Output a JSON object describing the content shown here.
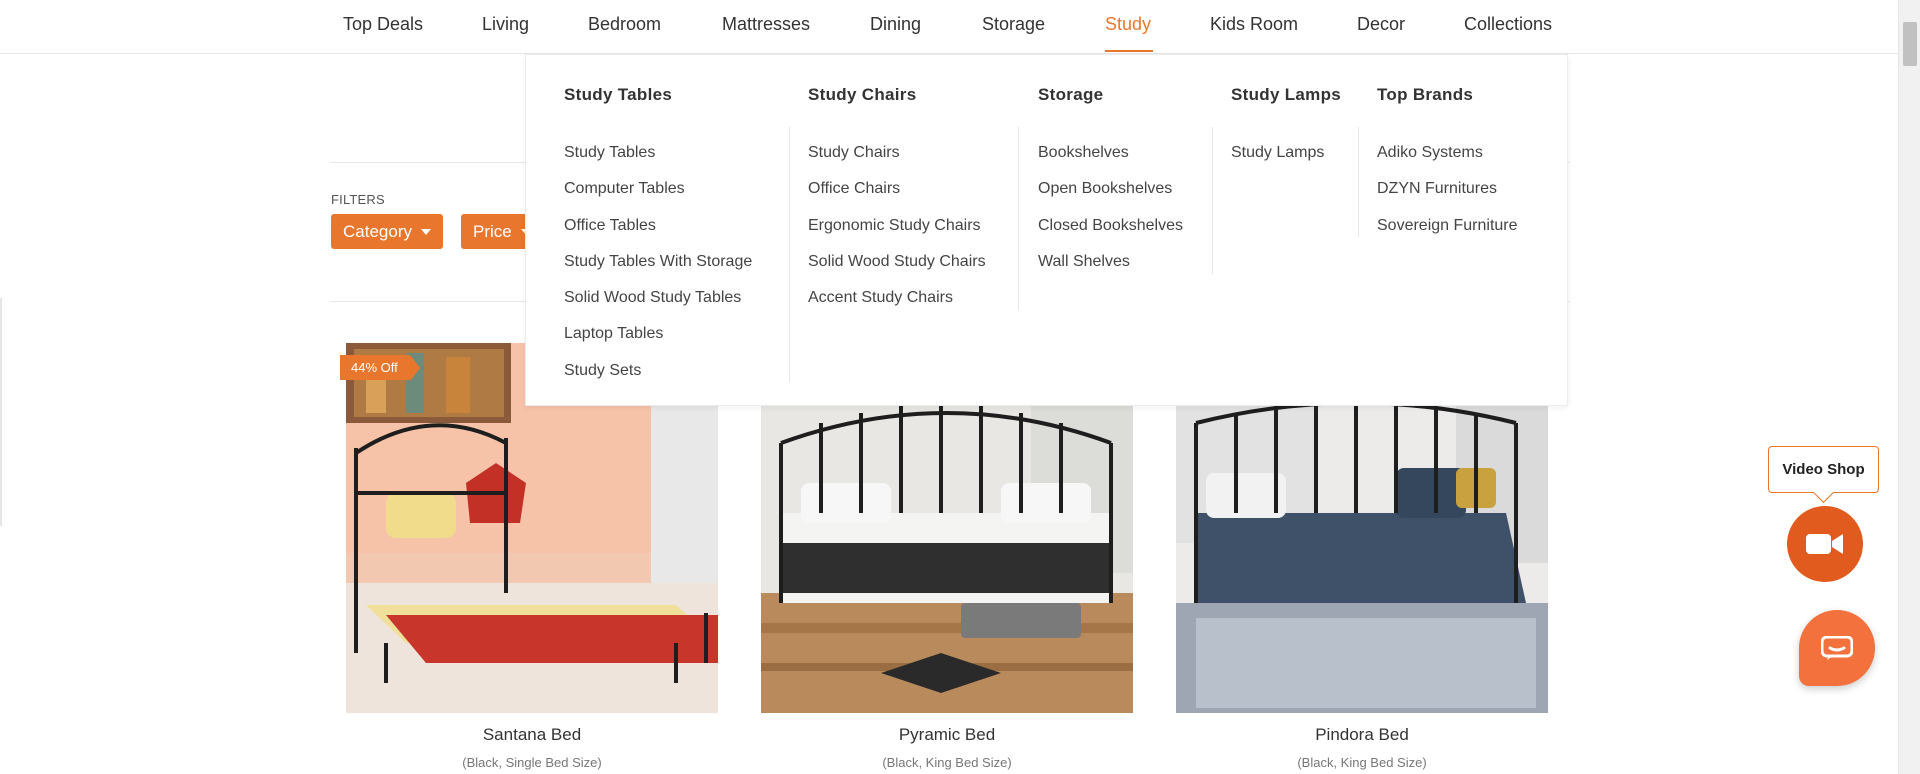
{
  "nav": {
    "items": [
      "Top Deals",
      "Living",
      "Bedroom",
      "Mattresses",
      "Dining",
      "Storage",
      "Study",
      "Kids Room",
      "Decor",
      "Collections"
    ],
    "active": "Study"
  },
  "filters": {
    "label": "FILTERS",
    "buttons": [
      "Category",
      "Price"
    ]
  },
  "mega_menu": {
    "columns": [
      {
        "heading": "Study Tables",
        "links": [
          "Study Tables",
          "Computer Tables",
          "Office Tables",
          "Study Tables With Storage",
          "Solid Wood Study Tables",
          "Laptop Tables",
          "Study Sets"
        ]
      },
      {
        "heading": "Study Chairs",
        "links": [
          "Study Chairs",
          "Office Chairs",
          "Ergonomic Study Chairs",
          "Solid Wood Study Chairs",
          "Accent Study Chairs"
        ]
      },
      {
        "heading": "Storage",
        "links": [
          "Bookshelves",
          "Open Bookshelves",
          "Closed Bookshelves",
          "Wall Shelves"
        ]
      },
      {
        "heading": "Study Lamps",
        "links": [
          "Study Lamps"
        ]
      },
      {
        "heading": "Top Brands",
        "links": [
          "Adiko Systems",
          "DZYN Furnitures",
          "Sovereign Furniture"
        ]
      }
    ]
  },
  "products": [
    {
      "name": "Santana Bed",
      "variant": "(Black, Single Bed Size)",
      "badge": "44% Off"
    },
    {
      "name": "Pyramic Bed",
      "variant": "(Black, King Bed Size)"
    },
    {
      "name": "Pindora Bed",
      "variant": "(Black, King Bed Size)"
    }
  ],
  "video_shop": {
    "label": "Video Shop"
  },
  "colors": {
    "accent": "#e8762c",
    "video_button": "#e25b1e",
    "chat_button": "#f2713c"
  }
}
